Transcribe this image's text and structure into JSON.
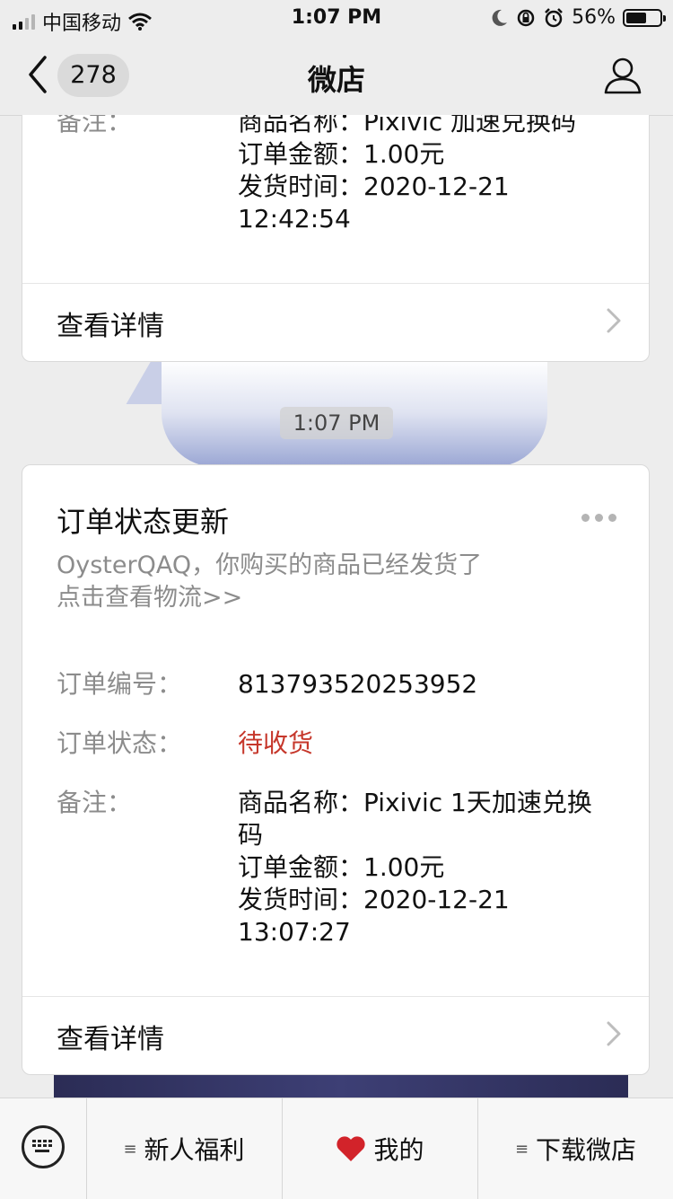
{
  "status": {
    "carrier": "中国移动",
    "time": "1:07 PM",
    "battery_pct": "56%"
  },
  "nav": {
    "back_count": "278",
    "title": "微店"
  },
  "card1": {
    "remark_label": "备注：",
    "remark_lines": [
      "商品名称：Pixivic 加速兑换码",
      "订单金额：1.00元",
      "发货时间：2020-12-21",
      "12:42:54"
    ],
    "detail_label": "查看详情"
  },
  "timestamp": "1:07 PM",
  "card2": {
    "title": "订单状态更新",
    "desc_line1": "OysterQAQ，你购买的商品已经发货了",
    "desc_line2": "点击查看物流>>",
    "order_no_label": "订单编号：",
    "order_no": "813793520253952",
    "status_label": "订单状态：",
    "status_value": "待收货",
    "status_color": "#c6372b",
    "remark_label": "备注：",
    "remark_lines": [
      "商品名称：Pixivic 1天加速兑换",
      "码",
      "订单金额：1.00元",
      "发货时间：2020-12-21",
      "13:07:27"
    ],
    "detail_label": "查看详情"
  },
  "toolbar": {
    "items": [
      {
        "label": "新人福利",
        "icon": "menu-icon"
      },
      {
        "label": "我的",
        "icon": "heart-icon"
      },
      {
        "label": "下载微店",
        "icon": "menu-icon"
      }
    ]
  }
}
